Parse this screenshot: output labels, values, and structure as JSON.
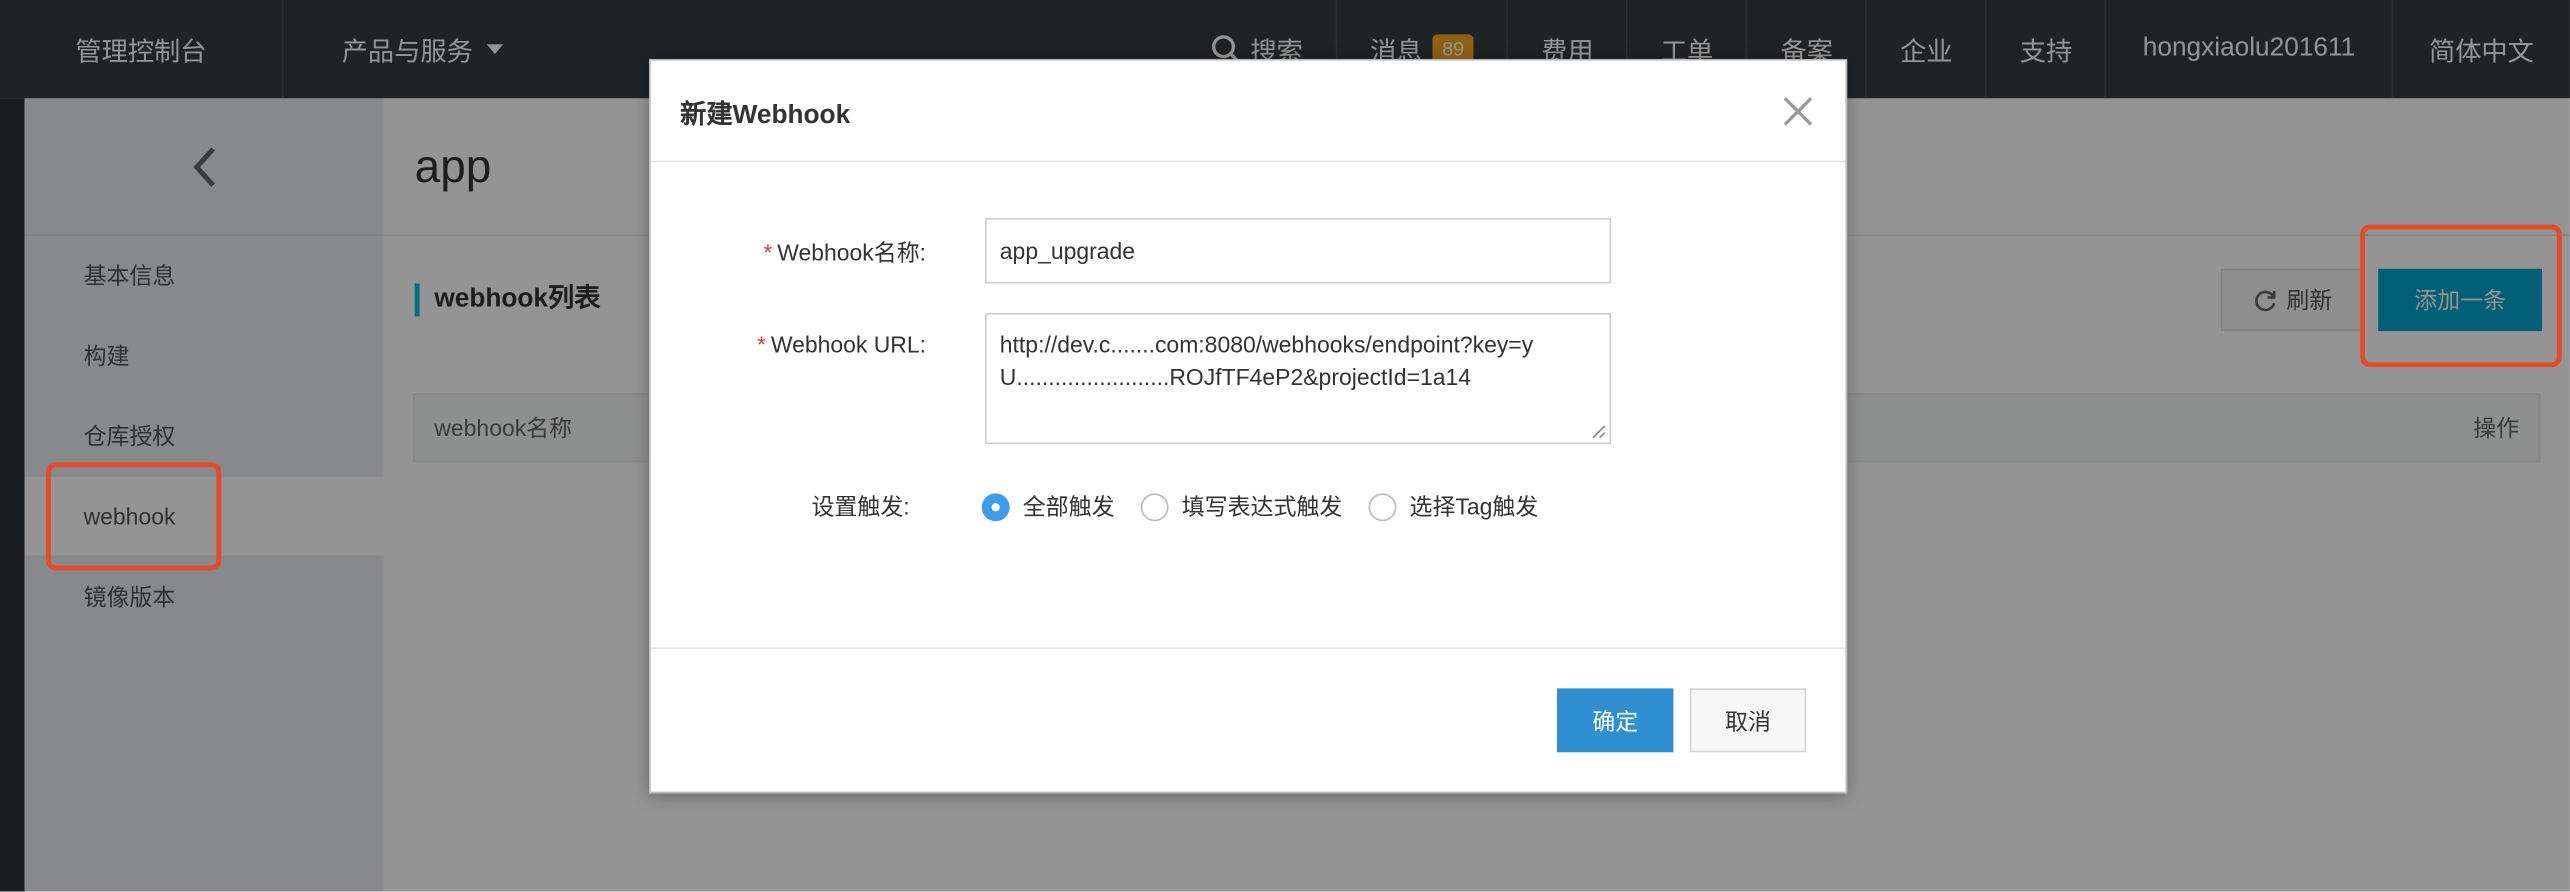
{
  "topbar": {
    "brand": "管理控制台",
    "products": "产品与服务",
    "search": "搜索",
    "messages": "消息",
    "messages_badge": "89",
    "billing": "费用",
    "tickets": "工单",
    "filing": "备案",
    "enterprise": "企业",
    "support": "支持",
    "user": "hongxiaolu201611",
    "language": "简体中文"
  },
  "sidebar": {
    "items": [
      {
        "label": "基本信息"
      },
      {
        "label": "构建"
      },
      {
        "label": "仓库授权"
      },
      {
        "label": "webhook"
      },
      {
        "label": "镜像版本"
      }
    ]
  },
  "main": {
    "title": "app",
    "section_title": "webhook列表",
    "refresh_label": "刷新",
    "add_label": "添加一条",
    "table_columns": [
      "webhook名称",
      "操作"
    ]
  },
  "modal": {
    "title": "新建Webhook",
    "name_label": "Webhook名称:",
    "name_value": "app_upgrade",
    "url_label": "Webhook URL:",
    "url_value": "http://dev.c.......com:8080/webhooks/endpoint?key=yU........................ROJfTF4eP2&projectId=1a14",
    "trigger_label": "设置触发:",
    "trigger_options": [
      "全部触发",
      "填写表达式触发",
      "选择Tag触发"
    ],
    "ok_label": "确定",
    "cancel_label": "取消"
  },
  "colors": {
    "topbar_bg": "#373d41",
    "accent": "#00a2ca",
    "primary_button": "#2f8fd0",
    "highlight": "#e34b2a",
    "badge": "#f5a623"
  }
}
